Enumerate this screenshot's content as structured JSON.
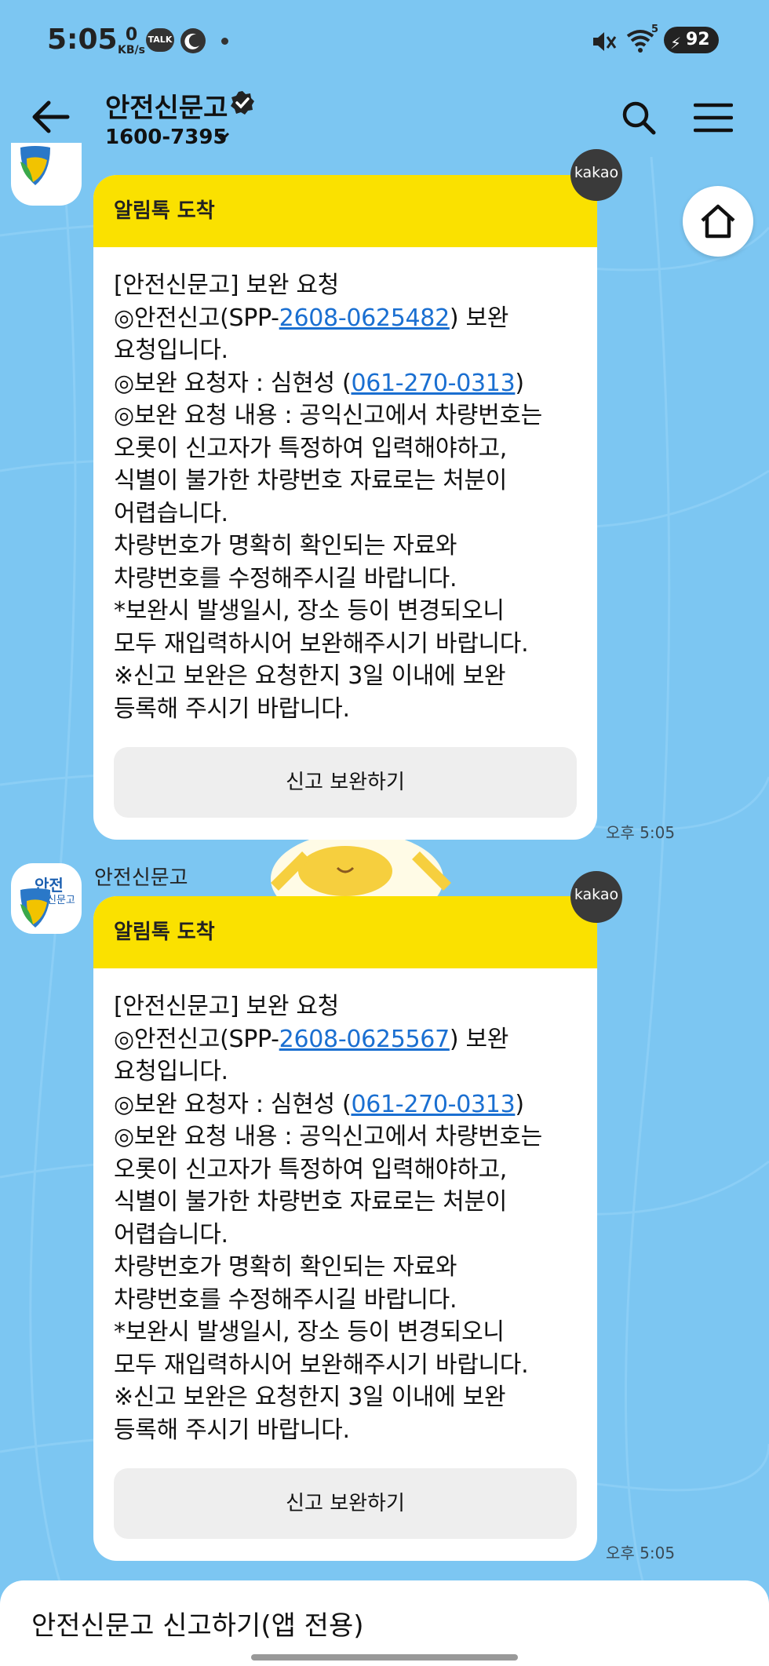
{
  "status_bar": {
    "time": "5:05",
    "speed_value": "0",
    "speed_unit": "KB/s",
    "talk_icon_label": "TALK",
    "battery": "92",
    "wifi_badge": "5"
  },
  "header": {
    "channel_name": "안전신문고",
    "phone": "1600-7395"
  },
  "messages": [
    {
      "sender": "",
      "head": "알림톡 도착",
      "l1": "[안전신문고] 보완 요청",
      "l2a": "◎안전신고(SPP-",
      "l2link": "2608-0625482",
      "l2b": ") 보완",
      "l3": "요청입니다.",
      "l4a": "◎보완 요청자 : 심현성 (",
      "l4link": "061-270-0313",
      "l4b": ")",
      "l5": "◎보완 요청 내용 : 공익신고에서 차량번호는",
      "l6": "오롯이 신고자가 특정하여 입력해야하고,",
      "l7": "식별이 불가한 차량번호 자료로는 처분이",
      "l8": "어렵습니다.",
      "l9": "차량번호가 명확히 확인되는 자료와",
      "l10": "차량번호를 수정해주시길 바랍니다.",
      "l11": "*보완시 발생일시, 장소 등이 변경되오니",
      "l12": "모두 재입력하시어 보완해주시기 바랍니다.",
      "l13": "※신고 보완은 요청한지 3일 이내에 보완",
      "l14": "등록해 주시기 바랍니다.",
      "button": "신고 보완하기",
      "badge": "kakao",
      "time": "오후 5:05"
    },
    {
      "sender": "안전신문고",
      "head": "알림톡 도착",
      "l1": "[안전신문고] 보완 요청",
      "l2a": "◎안전신고(SPP-",
      "l2link": "2608-0625567",
      "l2b": ") 보완",
      "l3": "요청입니다.",
      "l4a": "◎보완 요청자 : 심현성 (",
      "l4link": "061-270-0313",
      "l4b": ")",
      "l5": "◎보완 요청 내용 : 공익신고에서 차량번호는",
      "l6": "오롯이 신고자가 특정하여 입력해야하고,",
      "l7": "식별이 불가한 차량번호 자료로는 처분이",
      "l8": "어렵습니다.",
      "l9": "차량번호가 명확히 확인되는 자료와",
      "l10": "차량번호를 수정해주시길 바랍니다.",
      "l11": "*보완시 발생일시, 장소 등이 변경되오니",
      "l12": "모두 재입력하시어 보완해주시기 바랍니다.",
      "l13": "※신고 보완은 요청한지 3일 이내에 보완",
      "l14": "등록해 주시기 바랍니다.",
      "button": "신고 보완하기",
      "badge": "kakao",
      "time": "오후 5:05"
    }
  ],
  "avatar": {
    "line1": "안전",
    "line2": "신문고"
  },
  "bottom_bar": {
    "label": "안전신문고 신고하기(앱 전용)"
  },
  "colors": {
    "background": "#7cc6f2",
    "card_header": "#fae100",
    "link": "#1a6fd1"
  }
}
